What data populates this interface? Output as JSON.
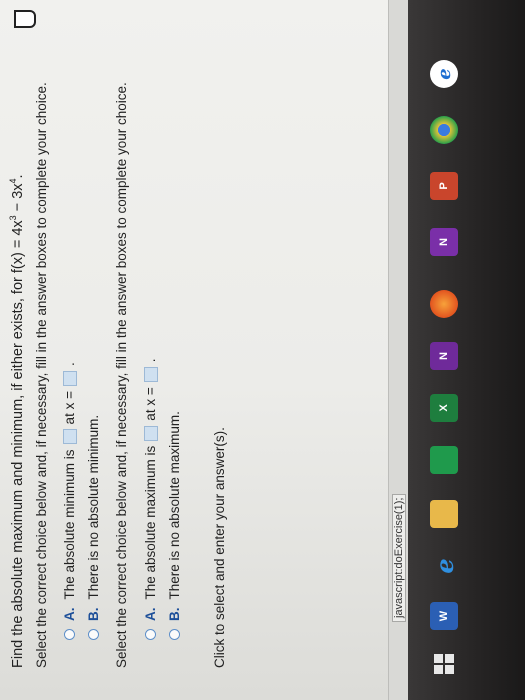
{
  "question": {
    "prefix": "Find the absolute maximum and minimum, if either exists, for f(x) = 4x",
    "exp1": "3",
    "mid": " − 3x",
    "exp2": "4",
    "suffix": "."
  },
  "part1": {
    "instruction": "Select the correct choice below and, if necessary, fill in the answer boxes to complete your choice.",
    "option_a": {
      "letter": "A.",
      "text_before": "The absolute minimum is",
      "text_mid": "at x =",
      "text_after": "."
    },
    "option_b": {
      "letter": "B.",
      "text": "There is no absolute minimum."
    }
  },
  "part2": {
    "instruction": "Select the correct choice below and, if necessary, fill in the answer boxes to complete your choice.",
    "option_a": {
      "letter": "A.",
      "text_before": "The absolute maximum is",
      "text_mid": "at x =",
      "text_after": "."
    },
    "option_b": {
      "letter": "B.",
      "text": "There is no absolute maximum."
    }
  },
  "hint": "Click to select and enter your answer(s).",
  "status_bar": {
    "text": "javascript:doExercise(1);"
  },
  "taskbar": {
    "items": [
      {
        "icon": "start-icon",
        "label": ""
      },
      {
        "icon": "word-icon",
        "label": "W"
      },
      {
        "icon": "internet-explorer-icon",
        "label": "e"
      },
      {
        "icon": "file-explorer-icon",
        "label": ""
      },
      {
        "icon": "store-icon",
        "label": ""
      },
      {
        "icon": "excel-icon",
        "label": "X"
      },
      {
        "icon": "onenote-icon",
        "label": "N"
      },
      {
        "icon": "firefox-icon",
        "label": ""
      },
      {
        "icon": "onenote-icon",
        "label": "N"
      },
      {
        "icon": "powerpoint-icon",
        "label": "P"
      },
      {
        "icon": "chrome-icon",
        "label": ""
      },
      {
        "icon": "internet-explorer-icon",
        "label": "e"
      }
    ]
  },
  "colors": {
    "accent": "#1d4f99",
    "answer_box": "#cfe0f0",
    "radio_border": "#5c8ec9",
    "taskbar": "#262424"
  }
}
